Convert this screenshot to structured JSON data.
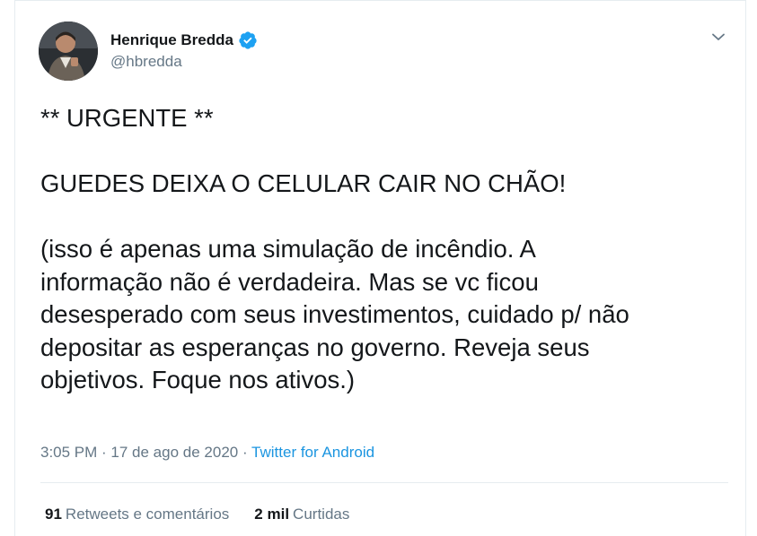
{
  "author": {
    "display_name": "Henrique Bredda",
    "handle": "@hbredda",
    "verified": true
  },
  "tweet": {
    "text": "** URGENTE **\n\nGUEDES DEIXA O CELULAR CAIR NO CHÃO!\n\n(isso é apenas uma simulação de incêndio. A\ninformação não é verdadeira. Mas se vc ficou\ndesesperado com seus investimentos, cuidado p/ não\ndepositar as esperanças no governo. Reveja seus\nobjetivos. Foque nos ativos.)",
    "time": "3:05 PM",
    "separator": " · ",
    "date": "17 de ago de 2020",
    "source": "Twitter for Android"
  },
  "stats": {
    "retweets_count": "91",
    "retweets_label": "Retweets e comentários",
    "likes_count": "2 mil",
    "likes_label": "Curtidas"
  },
  "colors": {
    "verified": "#1da1f2",
    "link": "#1b95e0",
    "secondary_text": "#657786",
    "border": "#e6ecf0"
  },
  "icons": {
    "verified": "verified-badge-icon",
    "menu": "chevron-down-icon"
  }
}
